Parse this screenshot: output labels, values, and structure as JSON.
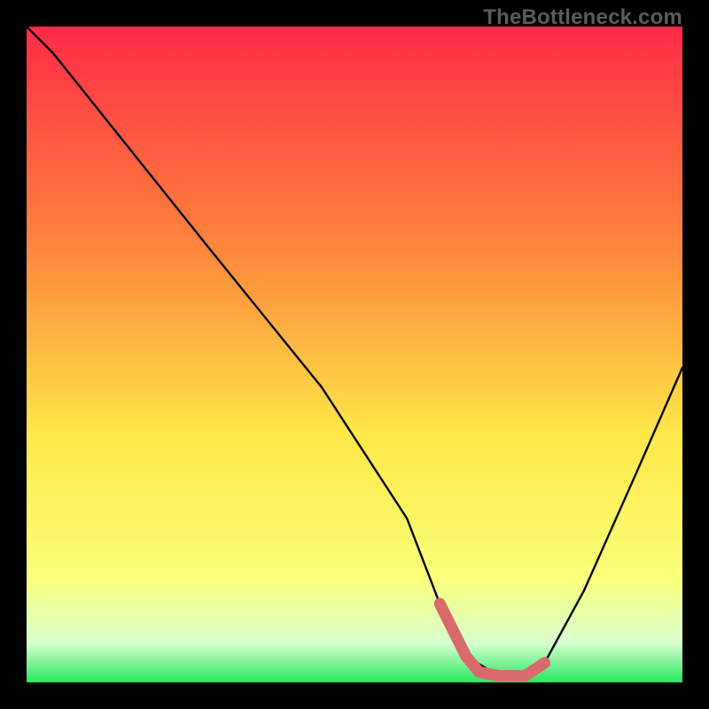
{
  "watermark": "TheBottleneck.com",
  "colors": {
    "gradient_top": "#ff2a47",
    "gradient_mid1": "#ff8a3d",
    "gradient_mid2": "#ffe748",
    "gradient_low1": "#fbff7a",
    "gradient_low2": "#d8ffcf",
    "gradient_bottom": "#25e85f",
    "curve": "#000000",
    "marker": "#d9696b",
    "frame": "#000000"
  },
  "chart_data": {
    "type": "line",
    "title": "",
    "xlabel": "",
    "ylabel": "",
    "xlim": [
      0,
      100
    ],
    "ylim": [
      0,
      100
    ],
    "series": [
      {
        "name": "bottleneck-curve",
        "x": [
          0,
          4,
          12,
          28,
          45,
          58,
          63,
          67,
          72,
          76,
          79,
          85,
          93,
          100
        ],
        "y": [
          100,
          96,
          86,
          66,
          45,
          25,
          12,
          4,
          1,
          1,
          3,
          14,
          32,
          48
        ]
      }
    ],
    "marker": {
      "name": "optimal-range",
      "x": [
        63,
        67,
        69,
        72,
        76,
        79
      ],
      "y": [
        12,
        4,
        1.6,
        1,
        1,
        3
      ]
    }
  }
}
